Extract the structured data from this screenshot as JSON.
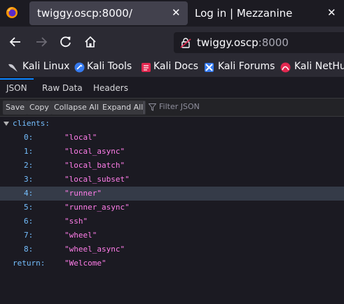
{
  "browser": {
    "tabs": [
      {
        "title": "twiggy.oscp:8000/",
        "active": true
      },
      {
        "title": "Log in | Mezzanine",
        "active": false
      }
    ],
    "url": {
      "host": "twiggy.oscp",
      "port": ":8000"
    },
    "bookmarks": [
      {
        "label": "Kali Linux",
        "icon": "kali-dragon-icon"
      },
      {
        "label": "Kali Tools",
        "icon": "kali-tools-icon"
      },
      {
        "label": "Kali Docs",
        "icon": "kali-docs-icon"
      },
      {
        "label": "Kali Forums",
        "icon": "kali-forums-icon"
      },
      {
        "label": "Kali NetHu",
        "icon": "kali-nethunter-icon"
      }
    ]
  },
  "viewer": {
    "tabs": [
      "JSON",
      "Raw Data",
      "Headers"
    ],
    "toolbar": {
      "save": "Save",
      "copy": "Copy",
      "collapse_all": "Collapse All",
      "expand_all": "Expand All",
      "filter_placeholder": "Filter JSON"
    },
    "tree": {
      "clients_key": "clients:",
      "clients": [
        {
          "index": "0:",
          "value": "\"local\""
        },
        {
          "index": "1:",
          "value": "\"local_async\""
        },
        {
          "index": "2:",
          "value": "\"local_batch\""
        },
        {
          "index": "3:",
          "value": "\"local_subset\""
        },
        {
          "index": "4:",
          "value": "\"runner\""
        },
        {
          "index": "5:",
          "value": "\"runner_async\""
        },
        {
          "index": "6:",
          "value": "\"ssh\""
        },
        {
          "index": "7:",
          "value": "\"wheel\""
        },
        {
          "index": "8:",
          "value": "\"wheel_async\""
        }
      ],
      "selected_index": 4,
      "return_key": "return:",
      "return_value": "\"Welcome\""
    }
  },
  "colors": {
    "key": "#75bfff",
    "string": "#ff7de9",
    "accent": "#0a84ff"
  }
}
